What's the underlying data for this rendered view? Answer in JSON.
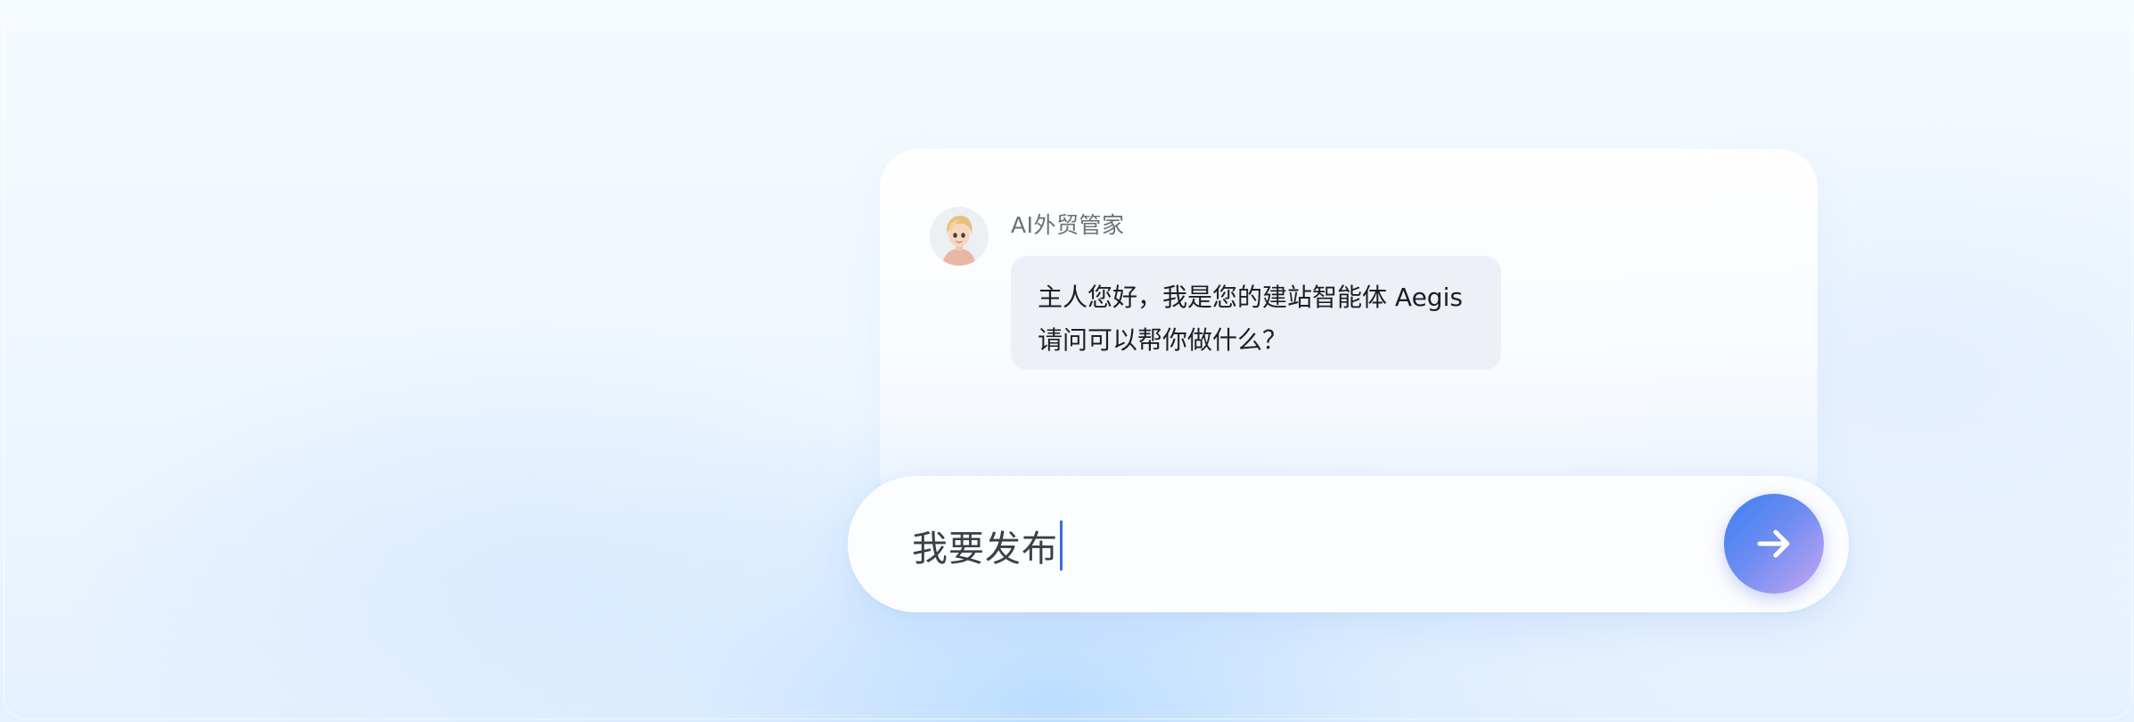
{
  "agent": {
    "name": "AI外贸管家",
    "avatar_icon": "cartoon-avatar-icon"
  },
  "message": {
    "line1": "主人您好，我是您的建站智能体 Aegis",
    "line2": "请问可以帮你做什么？"
  },
  "composer": {
    "value": "我要发布",
    "send_icon": "arrow-right-icon"
  },
  "colors": {
    "accent_start": "#3b7ff0",
    "accent_end": "#c8a6f2",
    "bubble_bg": "#edf1f7"
  }
}
